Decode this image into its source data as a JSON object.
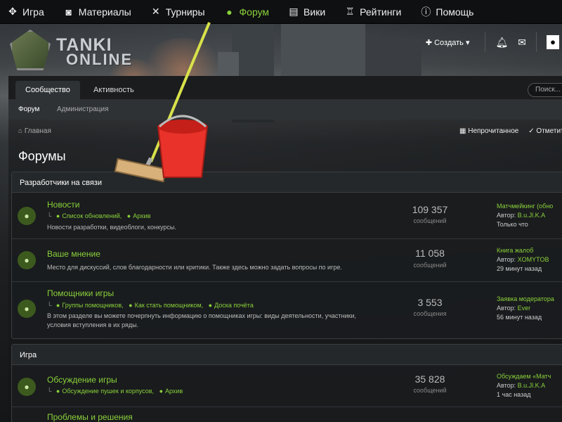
{
  "nav": {
    "items": [
      {
        "label": "Игра",
        "icon": "tank-icon"
      },
      {
        "label": "Материалы",
        "icon": "camera-icon"
      },
      {
        "label": "Турниры",
        "icon": "swords-icon"
      },
      {
        "label": "Форум",
        "icon": "chat-icon",
        "active": true
      },
      {
        "label": "Вики",
        "icon": "book-icon"
      },
      {
        "label": "Рейтинги",
        "icon": "trophy-icon"
      },
      {
        "label": "Помощь",
        "icon": "help-icon"
      }
    ]
  },
  "header": {
    "logo_line1": "TANKI",
    "logo_line2": "ONLINE",
    "create_label": "Создать"
  },
  "tabs": {
    "primary": [
      "Сообщество",
      "Активность"
    ],
    "secondary": [
      "Форум",
      "Администрация"
    ],
    "search_placeholder": "Поиск..."
  },
  "breadcrumb": {
    "home": "Главная",
    "unread": "Непрочитанное",
    "mark": "Отметить с"
  },
  "page_title": "Форумы",
  "sections": [
    {
      "title": "Разработчики на связи",
      "nodes": [
        {
          "title": "Новости",
          "subs": [
            "Список обновлений,",
            "Архив"
          ],
          "desc": "Новости разработки, видеоблоги, конкурсы.",
          "count": "109 357",
          "count_label": "сообщений",
          "last_title": "Матчмейкинг (обно",
          "author_prefix": "Автор:",
          "author": "B.u.Jl.K.A",
          "time": "Только что"
        },
        {
          "title": "Ваше мнение",
          "subs": [],
          "desc": "Место для дискуссий, слов благодарности или критики. Также здесь можно задать вопросы по игре.",
          "count": "11 058",
          "count_label": "сообщений",
          "last_title": "Книга жалоб",
          "author_prefix": "Автор:",
          "author": "XOMYTOB",
          "time": "29 минут назад"
        },
        {
          "title": "Помощники игры",
          "subs": [
            "Группы помощников,",
            "Как стать помощником,",
            "Доска почёта"
          ],
          "desc": "В этом разделе вы можете почерпнуть информацию о помощниках игры: виды деятельности, участники, условия вступления в их ряды.",
          "count": "3 553",
          "count_label": "сообщения",
          "last_title": "Заявка модератора",
          "author_prefix": "Автор:",
          "author": "Ever",
          "time": "56 минут назад"
        }
      ]
    },
    {
      "title": "Игра",
      "nodes": [
        {
          "title": "Обсуждение игры",
          "subs": [
            "Обсуждение пушек и корпусов,",
            "Архив"
          ],
          "desc": "",
          "count": "35 828",
          "count_label": "сообщений",
          "last_title": "Обсуждаем «Матч",
          "author_prefix": "Автор:",
          "author": "B.u.Jl.K.A",
          "time": "1 час назад"
        },
        {
          "title": "Проблемы и решения",
          "subs": [],
          "desc": "",
          "count": "",
          "count_label": "",
          "last_title": "",
          "author_prefix": "",
          "author": "",
          "time": ""
        }
      ]
    }
  ],
  "colors": {
    "accent": "#8ad13a",
    "nav_bg": "#0f1011",
    "panel_bg": "#1a1c1e",
    "node_icon_bg": "#3d5a1e"
  }
}
